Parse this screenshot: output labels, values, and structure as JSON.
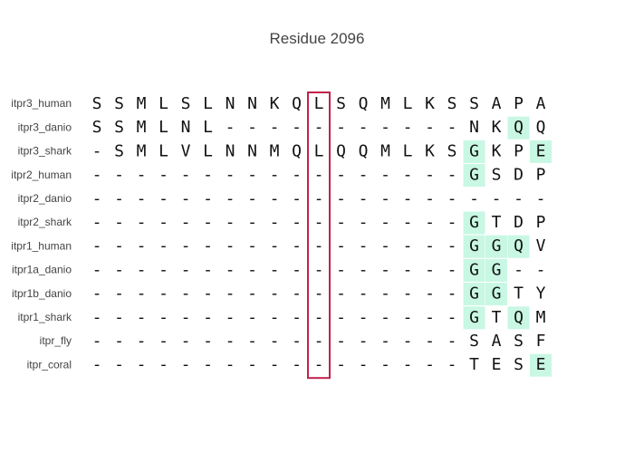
{
  "title": "Residue 2096",
  "colors": {
    "highlight": "#c8f7e4",
    "frame": "#c0224a",
    "label": "#444444",
    "residue": "#111111"
  },
  "alignment": {
    "highlight_column": 10,
    "rows": [
      {
        "label": "itpr3_human",
        "sequence": "SSMLSLNNKQLSQMLKSSAPA",
        "highlights": []
      },
      {
        "label": "itpr3_danio",
        "sequence": "SSMLNL-----------NKQQ",
        "highlights": [
          19
        ]
      },
      {
        "label": "itpr3_shark",
        "sequence": "-SMLVLNNMQLQQMLKSGKPE",
        "highlights": [
          17,
          20
        ]
      },
      {
        "label": "itpr2_human",
        "sequence": "-----------------GSDP",
        "highlights": [
          17
        ]
      },
      {
        "label": "itpr2_danio",
        "sequence": "---------------------",
        "highlights": []
      },
      {
        "label": "itpr2_shark",
        "sequence": "-----------------GTDP",
        "highlights": [
          17
        ]
      },
      {
        "label": "itpr1_human",
        "sequence": "-----------------GGQV",
        "highlights": [
          17,
          18,
          19
        ]
      },
      {
        "label": "itpr1a_danio",
        "sequence": "-----------------GG--",
        "highlights": [
          17,
          18
        ]
      },
      {
        "label": "itpr1b_danio",
        "sequence": "-----------------GGTY",
        "highlights": [
          17,
          18
        ]
      },
      {
        "label": "itpr1_shark",
        "sequence": "-----------------GTQM",
        "highlights": [
          17,
          19
        ]
      },
      {
        "label": "itpr_fly",
        "sequence": "-----------------SASF",
        "highlights": []
      },
      {
        "label": "itpr_coral",
        "sequence": "-----------------TESE",
        "highlights": [
          20
        ]
      }
    ]
  }
}
